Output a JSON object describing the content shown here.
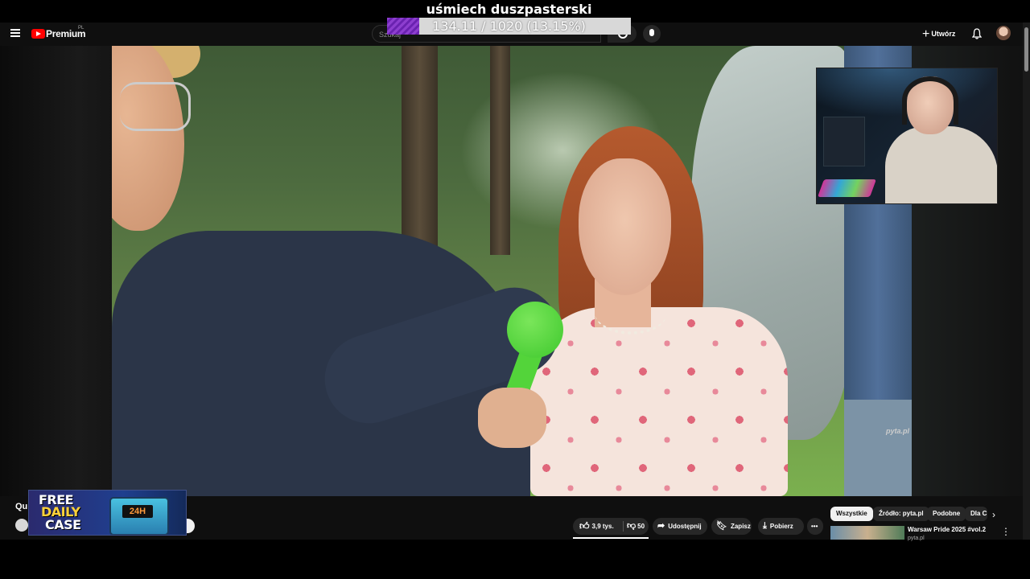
{
  "overlay": {
    "stream_title": "uśmiech duszpasterski",
    "progress_text": "134.11 / 1020 (13.15%)",
    "progress_fraction": 0.1315
  },
  "header": {
    "logo_text": "Premium",
    "country_code": "PL",
    "search_placeholder": "Szukaj",
    "create_label": "Utwórz"
  },
  "video": {
    "watermark": "pyta.pl"
  },
  "below_video": {
    "title_partial": "Qu"
  },
  "ad": {
    "line1": "FREE",
    "line2": "DAILY",
    "line3": "CASE",
    "badge": "24H"
  },
  "actions": {
    "likes": "3,9 tys.",
    "dislikes": "50",
    "share": "Udostępnij",
    "save": "Zapisz",
    "download": "Pobierz"
  },
  "chips": [
    "Wszystkie",
    "Źródło: pyta.pl",
    "Podobne",
    "Dla Ciebie"
  ],
  "recommendation": {
    "title": "Warsaw Pride 2025 #vol.2",
    "channel": "pyta.pl"
  },
  "colors": {
    "background": "#0f0f0f",
    "brand_red": "#ff0000",
    "progress_purple": "#8d3ecf",
    "mic_green": "#53d43a"
  }
}
